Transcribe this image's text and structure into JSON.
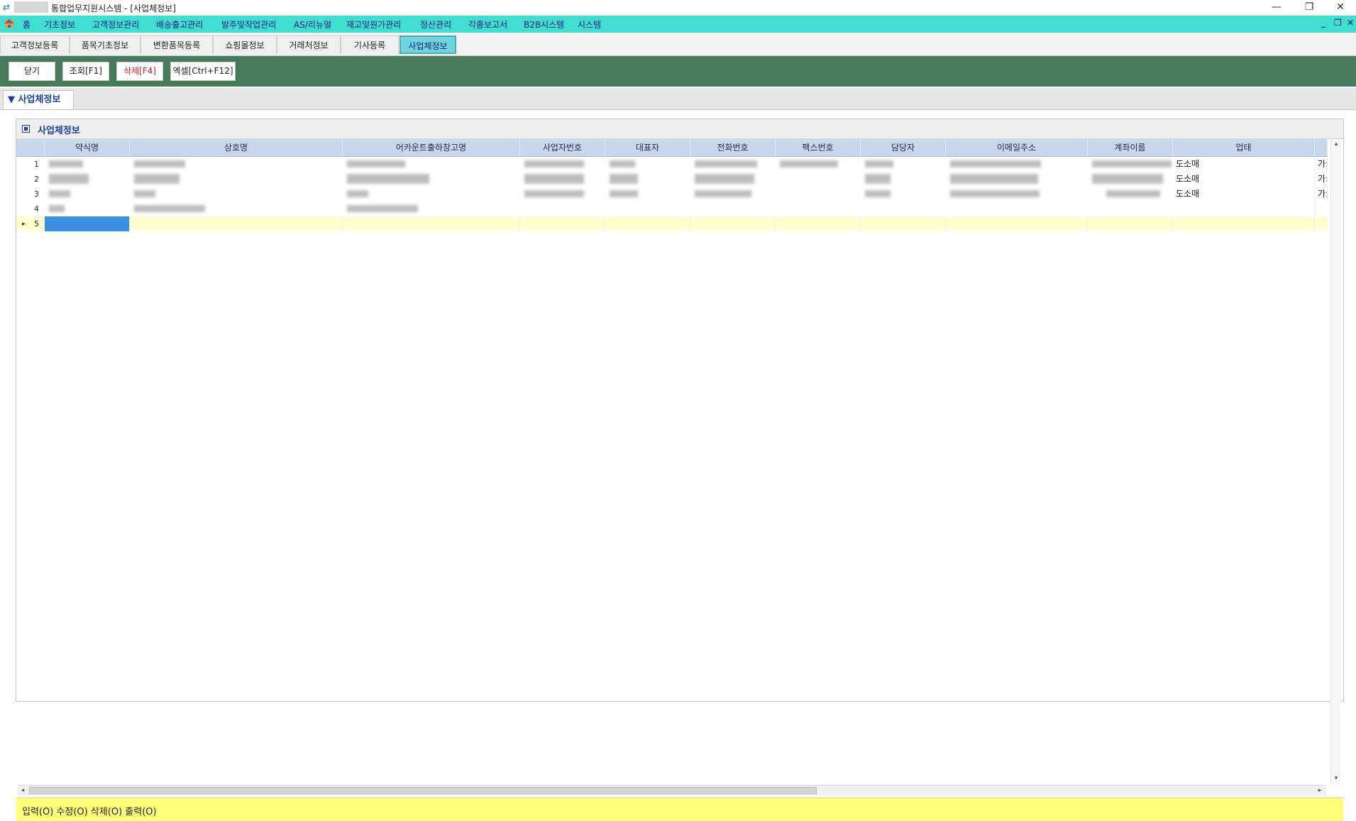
{
  "window": {
    "title": "통합업무지원시스템 - [사업체정보]",
    "minimize": "—",
    "restore": "❐",
    "close": "✕"
  },
  "menu": {
    "items": [
      "홈",
      "기초정보",
      "고객정보관리",
      "배송출고관리",
      "발주및작업관리",
      "AS/리뉴얼",
      "재고및원가관리",
      "정산관리",
      "각종보고서",
      "B2B시스템",
      "시스템"
    ],
    "mdi_minimize": "_",
    "mdi_restore": "❐",
    "mdi_close": "✕"
  },
  "tabs": [
    "고객정보등록",
    "품목기초정보",
    "변환품목등록",
    "쇼핑몰정보",
    "거래처정보",
    "기사등록",
    "사업체정보"
  ],
  "active_tab": "사업체정보",
  "toolbar": {
    "close": "닫기",
    "search": "조회[F1]",
    "delete": "삭제[F4]",
    "excel": "엑셀[Ctrl+F12]"
  },
  "section": {
    "tab_label": "▼ 사업체정보",
    "panel_title": "사업체정보"
  },
  "grid": {
    "columns": [
      "약식명",
      "상호명",
      "어카운트출하창고명",
      "사업자번호",
      "대표자",
      "전화번호",
      "팩스번호",
      "담당자",
      "이메일주소",
      "계좌이름",
      "업태"
    ],
    "rows": [
      {
        "num": "1",
        "업태": "도소매",
        "extra": "가:"
      },
      {
        "num": "2",
        "업태": "도소매",
        "extra": "가:"
      },
      {
        "num": "3",
        "업태": "도소매",
        "extra": "가:"
      },
      {
        "num": "4",
        "업태": "",
        "extra": ""
      },
      {
        "num": "5",
        "업태": "",
        "extra": ""
      }
    ]
  },
  "status": {
    "text": "입력(O) 수정(O) 삭제(O) 출력(O)"
  },
  "colors": {
    "menu_bg": "#40ddd0",
    "toolbar_bg": "#467a5a",
    "status_bg": "#ffff78",
    "grid_header_bg": "#c8d8ec",
    "new_row_bg": "#ffffd2",
    "selection": "#3a8fe0"
  }
}
